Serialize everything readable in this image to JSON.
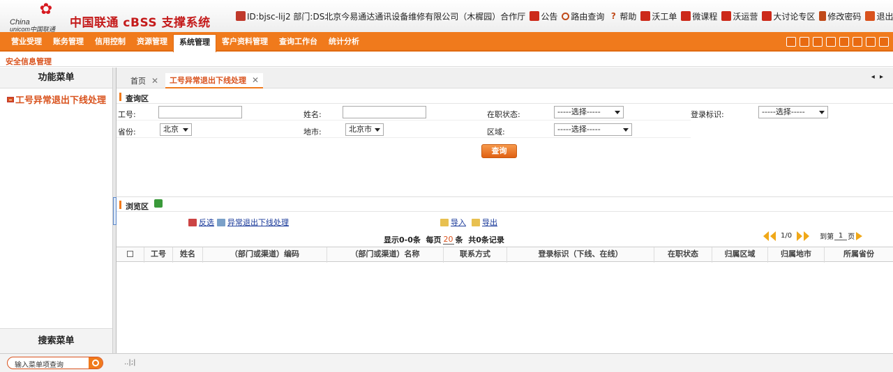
{
  "brand": {
    "logo_line1": "China",
    "logo_line2": "unicom中国联通",
    "title": "中国联通 cBSS 支撑系统"
  },
  "topbar": {
    "user": "ID:bjsc-lij2  部门:DS北京今易通达通讯设备维修有限公司（木樨园）合作厅",
    "links": [
      "公告",
      "路由查询",
      "帮助",
      "沃工单",
      "微课程",
      "沃运营",
      "大讨论专区",
      "修改密码",
      "退出"
    ]
  },
  "nav": {
    "tabs": [
      "营业受理",
      "账务管理",
      "信用控制",
      "资源管理",
      "系统管理",
      "客户资料管理",
      "查询工作台",
      "统计分析"
    ],
    "active": "系统管理"
  },
  "breadcrumb": "安全信息管理",
  "sidebar": {
    "title": "功能菜单",
    "item": "工号异常退出下线处理",
    "search_title": "搜索菜单"
  },
  "tabs": {
    "home": "首页",
    "current": "工号异常退出下线处理",
    "nav_glyph": "◂ ▸"
  },
  "query": {
    "section_title": "查询区",
    "staff_id_label": "工号:",
    "name_label": "姓名:",
    "status_label": "在职状态:",
    "status_value": "-----选择-----",
    "login_flag_label": "登录标识:",
    "login_flag_value": "-----选择-----",
    "province_label": "省份:",
    "province_value": "北京",
    "city_label": "地市:",
    "city_value": "北京市",
    "area_label": "区域:",
    "area_value": "-----选择-----",
    "query_button": "查询"
  },
  "browse": {
    "section_title": "浏览区",
    "invert_select": "反选",
    "abnormal_logout": "异常退出下线处理",
    "import": "导入",
    "export": "导出",
    "display_text": "显示0-0条",
    "per_page_label": "每页",
    "per_page_value": "20",
    "per_page_unit": "条",
    "total_text": "共0条记录",
    "page_text": "1/0",
    "goto_label": "到第",
    "goto_value": "1",
    "goto_unit": "页",
    "columns": [
      "工号",
      "姓名",
      "（部门或渠道）编码",
      "（部门或渠道）名称",
      "联系方式",
      "登录标识（下线、在线）",
      "在职状态",
      "归属区域",
      "归属地市",
      "所属省份"
    ]
  },
  "footer": {
    "search_placeholder": "输入菜单项查询",
    "mark": "..|;|"
  }
}
